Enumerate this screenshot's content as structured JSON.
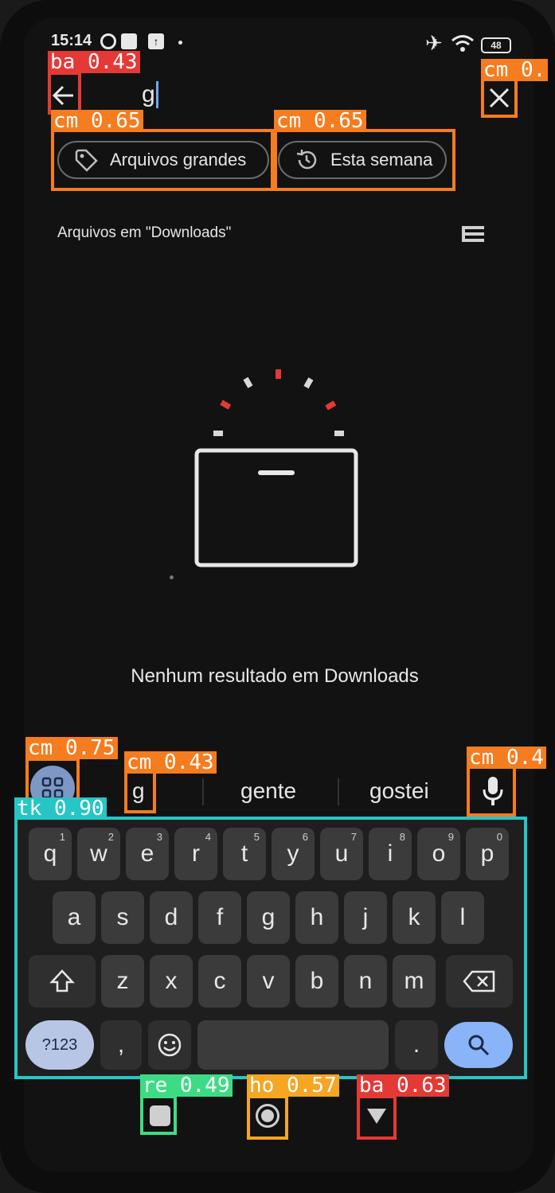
{
  "status_bar": {
    "time": "15:14",
    "battery": "48"
  },
  "search": {
    "query": "g"
  },
  "filters": [
    {
      "label": "Arquivos grandes"
    },
    {
      "label": "Esta semana"
    }
  ],
  "section": {
    "title": "Arquivos em \"Downloads\""
  },
  "empty_state": {
    "message": "Nenhum resultado em Downloads"
  },
  "suggestions": [
    "g",
    "gente",
    "gostei"
  ],
  "keyboard": {
    "row1": [
      {
        "k": "q",
        "n": "1"
      },
      {
        "k": "w",
        "n": "2"
      },
      {
        "k": "e",
        "n": "3"
      },
      {
        "k": "r",
        "n": "4"
      },
      {
        "k": "t",
        "n": "5"
      },
      {
        "k": "y",
        "n": "6"
      },
      {
        "k": "u",
        "n": "7"
      },
      {
        "k": "i",
        "n": "8"
      },
      {
        "k": "o",
        "n": "9"
      },
      {
        "k": "p",
        "n": "0"
      }
    ],
    "row2": [
      "a",
      "s",
      "d",
      "f",
      "g",
      "h",
      "j",
      "k",
      "l"
    ],
    "row3": [
      "z",
      "x",
      "c",
      "v",
      "b",
      "n",
      "m"
    ],
    "symbols_label": "?123",
    "comma": ",",
    "period": "."
  },
  "detections": [
    {
      "label": "ba 0.43",
      "color": "#e53935"
    },
    {
      "label": "cm 0.",
      "color": "#f57c1f"
    },
    {
      "label": "cm 0.65",
      "color": "#f57c1f"
    },
    {
      "label": "cm 0.65",
      "color": "#f57c1f"
    },
    {
      "label": "cm 0.75",
      "color": "#f57c1f"
    },
    {
      "label": "cm 0.43",
      "color": "#f57c1f"
    },
    {
      "label": "cm 0.4",
      "color": "#f57c1f"
    },
    {
      "label": "tk 0.90",
      "color": "#26c6c6"
    },
    {
      "label": "re 0.49",
      "color": "#3ddc84"
    },
    {
      "label": "ho 0.57",
      "color": "#f5a623"
    },
    {
      "label": "ba 0.63",
      "color": "#e53935"
    }
  ]
}
